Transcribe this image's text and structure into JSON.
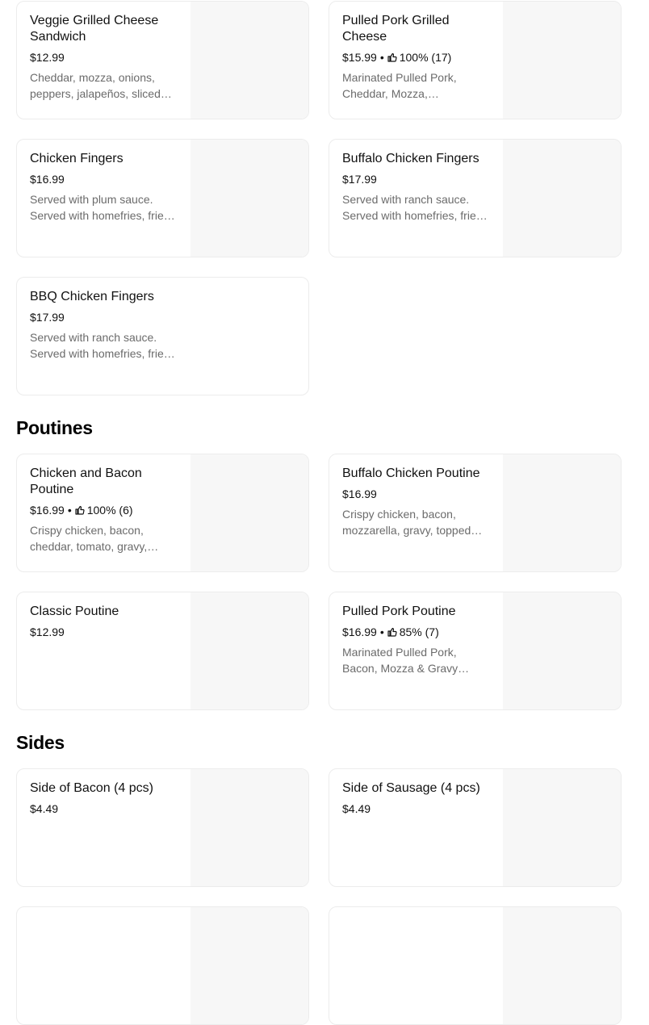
{
  "sections": [
    {
      "title": "",
      "items": [
        {
          "name": "Veggie Grilled Cheese Sandwich",
          "price": "$12.99",
          "rating": "",
          "desc": "Cheddar, mozza, onions, peppers, jalapeños, sliced tomatoes and pickles"
        },
        {
          "name": "Pulled Pork Grilled Cheese",
          "price": "$15.99",
          "rating": "100% (17)",
          "desc": "Marinated Pulled Pork, Cheddar, Mozza, Caramelized Onions"
        },
        {
          "name": "Chicken Fingers",
          "price": "$16.99",
          "rating": "",
          "desc": "Served with plum sauce. Served with homefries, fries or salad"
        },
        {
          "name": "Buffalo Chicken Fingers",
          "price": "$17.99",
          "rating": "",
          "desc": "Served with ranch sauce. Served with homefries, fries or salad"
        },
        {
          "name": "BBQ Chicken Fingers",
          "price": "$17.99",
          "rating": "",
          "desc": "Served with ranch sauce. Served with homefries, fries or salad"
        }
      ]
    },
    {
      "title": "Poutines",
      "items": [
        {
          "name": "Chicken and Bacon Poutine",
          "price": "$16.99",
          "rating": "100% (6)",
          "desc": "Crispy chicken, bacon, cheddar, tomato, gravy, mozzarella"
        },
        {
          "name": "Buffalo Chicken Poutine",
          "price": "$16.99",
          "rating": "",
          "desc": "Crispy chicken, bacon, mozzarella, gravy, topped with buffalo sauce"
        },
        {
          "name": "Classic Poutine",
          "price": "$12.99",
          "rating": "",
          "desc": ""
        },
        {
          "name": "Pulled Pork Poutine",
          "price": "$16.99",
          "rating": "85% (7)",
          "desc": "Marinated Pulled Pork, Bacon, Mozza & Gravy topped with BBQ sauce"
        }
      ]
    },
    {
      "title": "Sides",
      "items": [
        {
          "name": "Side of Bacon (4 pcs)",
          "price": "$4.49",
          "rating": "",
          "desc": ""
        },
        {
          "name": "Side of Sausage (4 pcs)",
          "price": "$4.49",
          "rating": "",
          "desc": ""
        },
        {
          "name": "",
          "price": "",
          "rating": "",
          "desc": ""
        },
        {
          "name": "",
          "price": "",
          "rating": "",
          "desc": ""
        }
      ]
    }
  ],
  "icons": {
    "rating": "thumbs-up-icon"
  },
  "separator": "•"
}
